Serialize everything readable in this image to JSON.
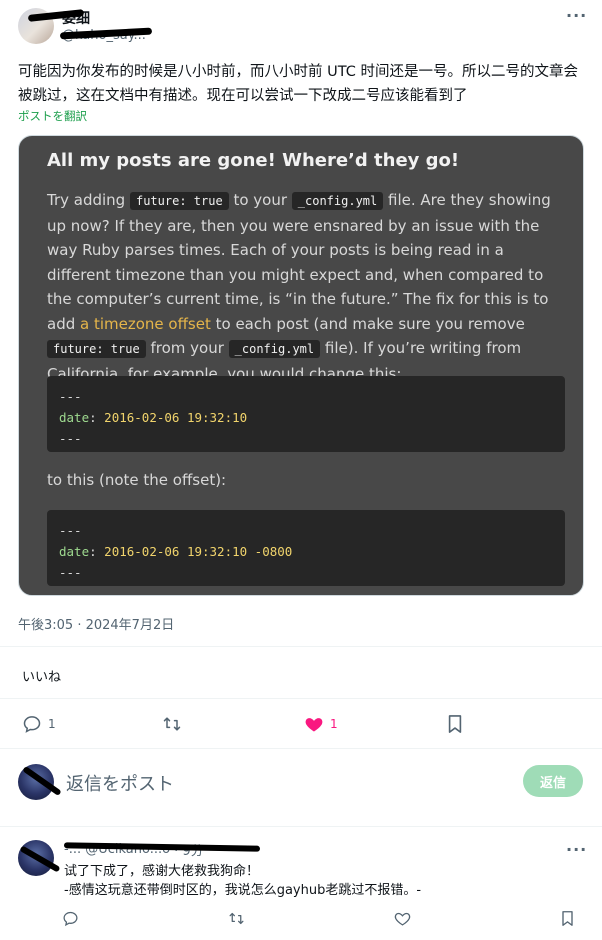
{
  "post": {
    "author": {
      "name": "委细",
      "handle": "@kaho_say..."
    },
    "text": "可能因为你发布的时候是八小时前，而八小时前 UTC 时间还是一号。所以二号的文章会被跳过，这在文档中有描述。现在可以尝试一下改成二号应该能看到了",
    "translate_label": "ポストを翻訳",
    "embedded_doc": {
      "title": "All my posts are gone! Where’d they go!",
      "para": {
        "t1": "Try adding ",
        "c1": "future: true",
        "t2": " to your ",
        "c2": "_config.yml",
        "t3": " file. Are they showing up now? If they are, then you were ensnared by an issue with the way Ruby parses times. Each of your posts is being read in a different timezone than you might expect and, when compared to the computer’s current time, is “in the future.” The fix for this is to add ",
        "link": "a timezone offset",
        "t4": " to each post (and make sure you remove ",
        "c3": "future: true",
        "t5": " from your ",
        "c4": "_config.yml",
        "t6": " file). If you’re writing from California, for example, you would change this:"
      },
      "code1": {
        "dash_top": "---",
        "key": "date",
        "sep": ": ",
        "value": "2016-02-06 19:32:10",
        "dash_bottom": "---"
      },
      "middle_text": "to this (note the offset):",
      "code2": {
        "dash_top": "---",
        "key": "date",
        "sep": ": ",
        "value": "2016-02-06 19:32:10 -0800",
        "dash_bottom": "---"
      }
    },
    "timestamp": "午後3:05 · 2024年7月2日",
    "likes_label": "いいね",
    "actions": {
      "reply_count": "1",
      "like_count": "1"
    }
  },
  "composer": {
    "placeholder": "返信をポスト",
    "submit_label": "返信"
  },
  "reply": {
    "author_line": "-... @Ucikano...o",
    "time": "· 9分",
    "line1": "试了下成了，感谢大佬救我狗命！",
    "line2": "-感情这玩意还带倒时区的，我说怎么gayhub老跳过不报错。-"
  },
  "colors": {
    "accent_green": "#1b9e4b",
    "like_pink": "#f91880",
    "reply_button_disabled": "#9fdcb7",
    "doc_link": "#e5b54a"
  }
}
